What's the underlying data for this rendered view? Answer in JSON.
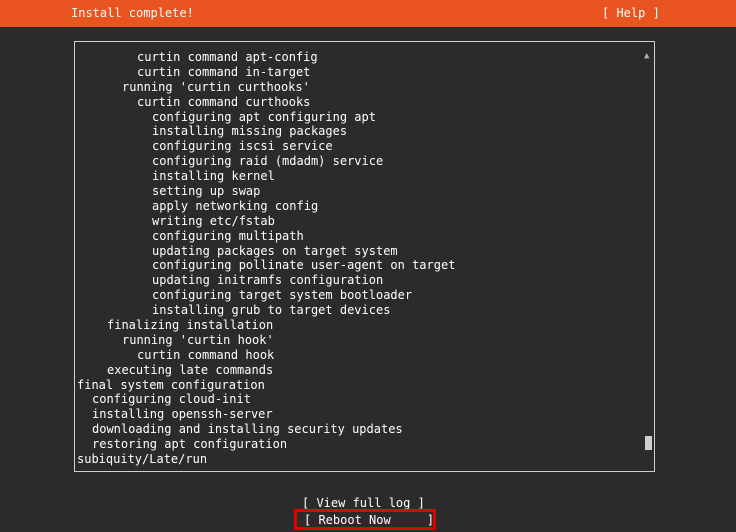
{
  "header": {
    "title": "Install complete!",
    "help_label": "[ Help ]"
  },
  "log": {
    "lines": [
      {
        "text": "curtin command apt-config",
        "indent": 4
      },
      {
        "text": "curtin command in-target",
        "indent": 4
      },
      {
        "text": "running 'curtin curthooks'",
        "indent": 3
      },
      {
        "text": "curtin command curthooks",
        "indent": 4
      },
      {
        "text": "configuring apt configuring apt",
        "indent": 5
      },
      {
        "text": "installing missing packages",
        "indent": 5
      },
      {
        "text": "configuring iscsi service",
        "indent": 5
      },
      {
        "text": "configuring raid (mdadm) service",
        "indent": 5
      },
      {
        "text": "installing kernel",
        "indent": 5
      },
      {
        "text": "setting up swap",
        "indent": 5
      },
      {
        "text": "apply networking config",
        "indent": 5
      },
      {
        "text": "writing etc/fstab",
        "indent": 5
      },
      {
        "text": "configuring multipath",
        "indent": 5
      },
      {
        "text": "updating packages on target system",
        "indent": 5
      },
      {
        "text": "configuring pollinate user-agent on target",
        "indent": 5
      },
      {
        "text": "updating initramfs configuration",
        "indent": 5
      },
      {
        "text": "configuring target system bootloader",
        "indent": 5
      },
      {
        "text": "installing grub to target devices",
        "indent": 5
      },
      {
        "text": "finalizing installation",
        "indent": 2
      },
      {
        "text": "running 'curtin hook'",
        "indent": 3
      },
      {
        "text": "curtin command hook",
        "indent": 4
      },
      {
        "text": "executing late commands",
        "indent": 2
      },
      {
        "text": "final system configuration",
        "indent": 0
      },
      {
        "text": "configuring cloud-init",
        "indent": 1
      },
      {
        "text": "installing openssh-server",
        "indent": 1
      },
      {
        "text": "downloading and installing security updates",
        "indent": 1
      },
      {
        "text": "restoring apt configuration",
        "indent": 1
      },
      {
        "text": "subiquity/Late/run",
        "indent": 0
      }
    ],
    "scroll_up_glyph": "▲"
  },
  "buttons": {
    "view_log_label": "[ View full log ]",
    "reboot_label": "[ Reboot Now     ]"
  },
  "colors": {
    "header_bg": "#e95420",
    "screen_bg": "#2b2b2b",
    "highlight_border": "#e00000"
  }
}
